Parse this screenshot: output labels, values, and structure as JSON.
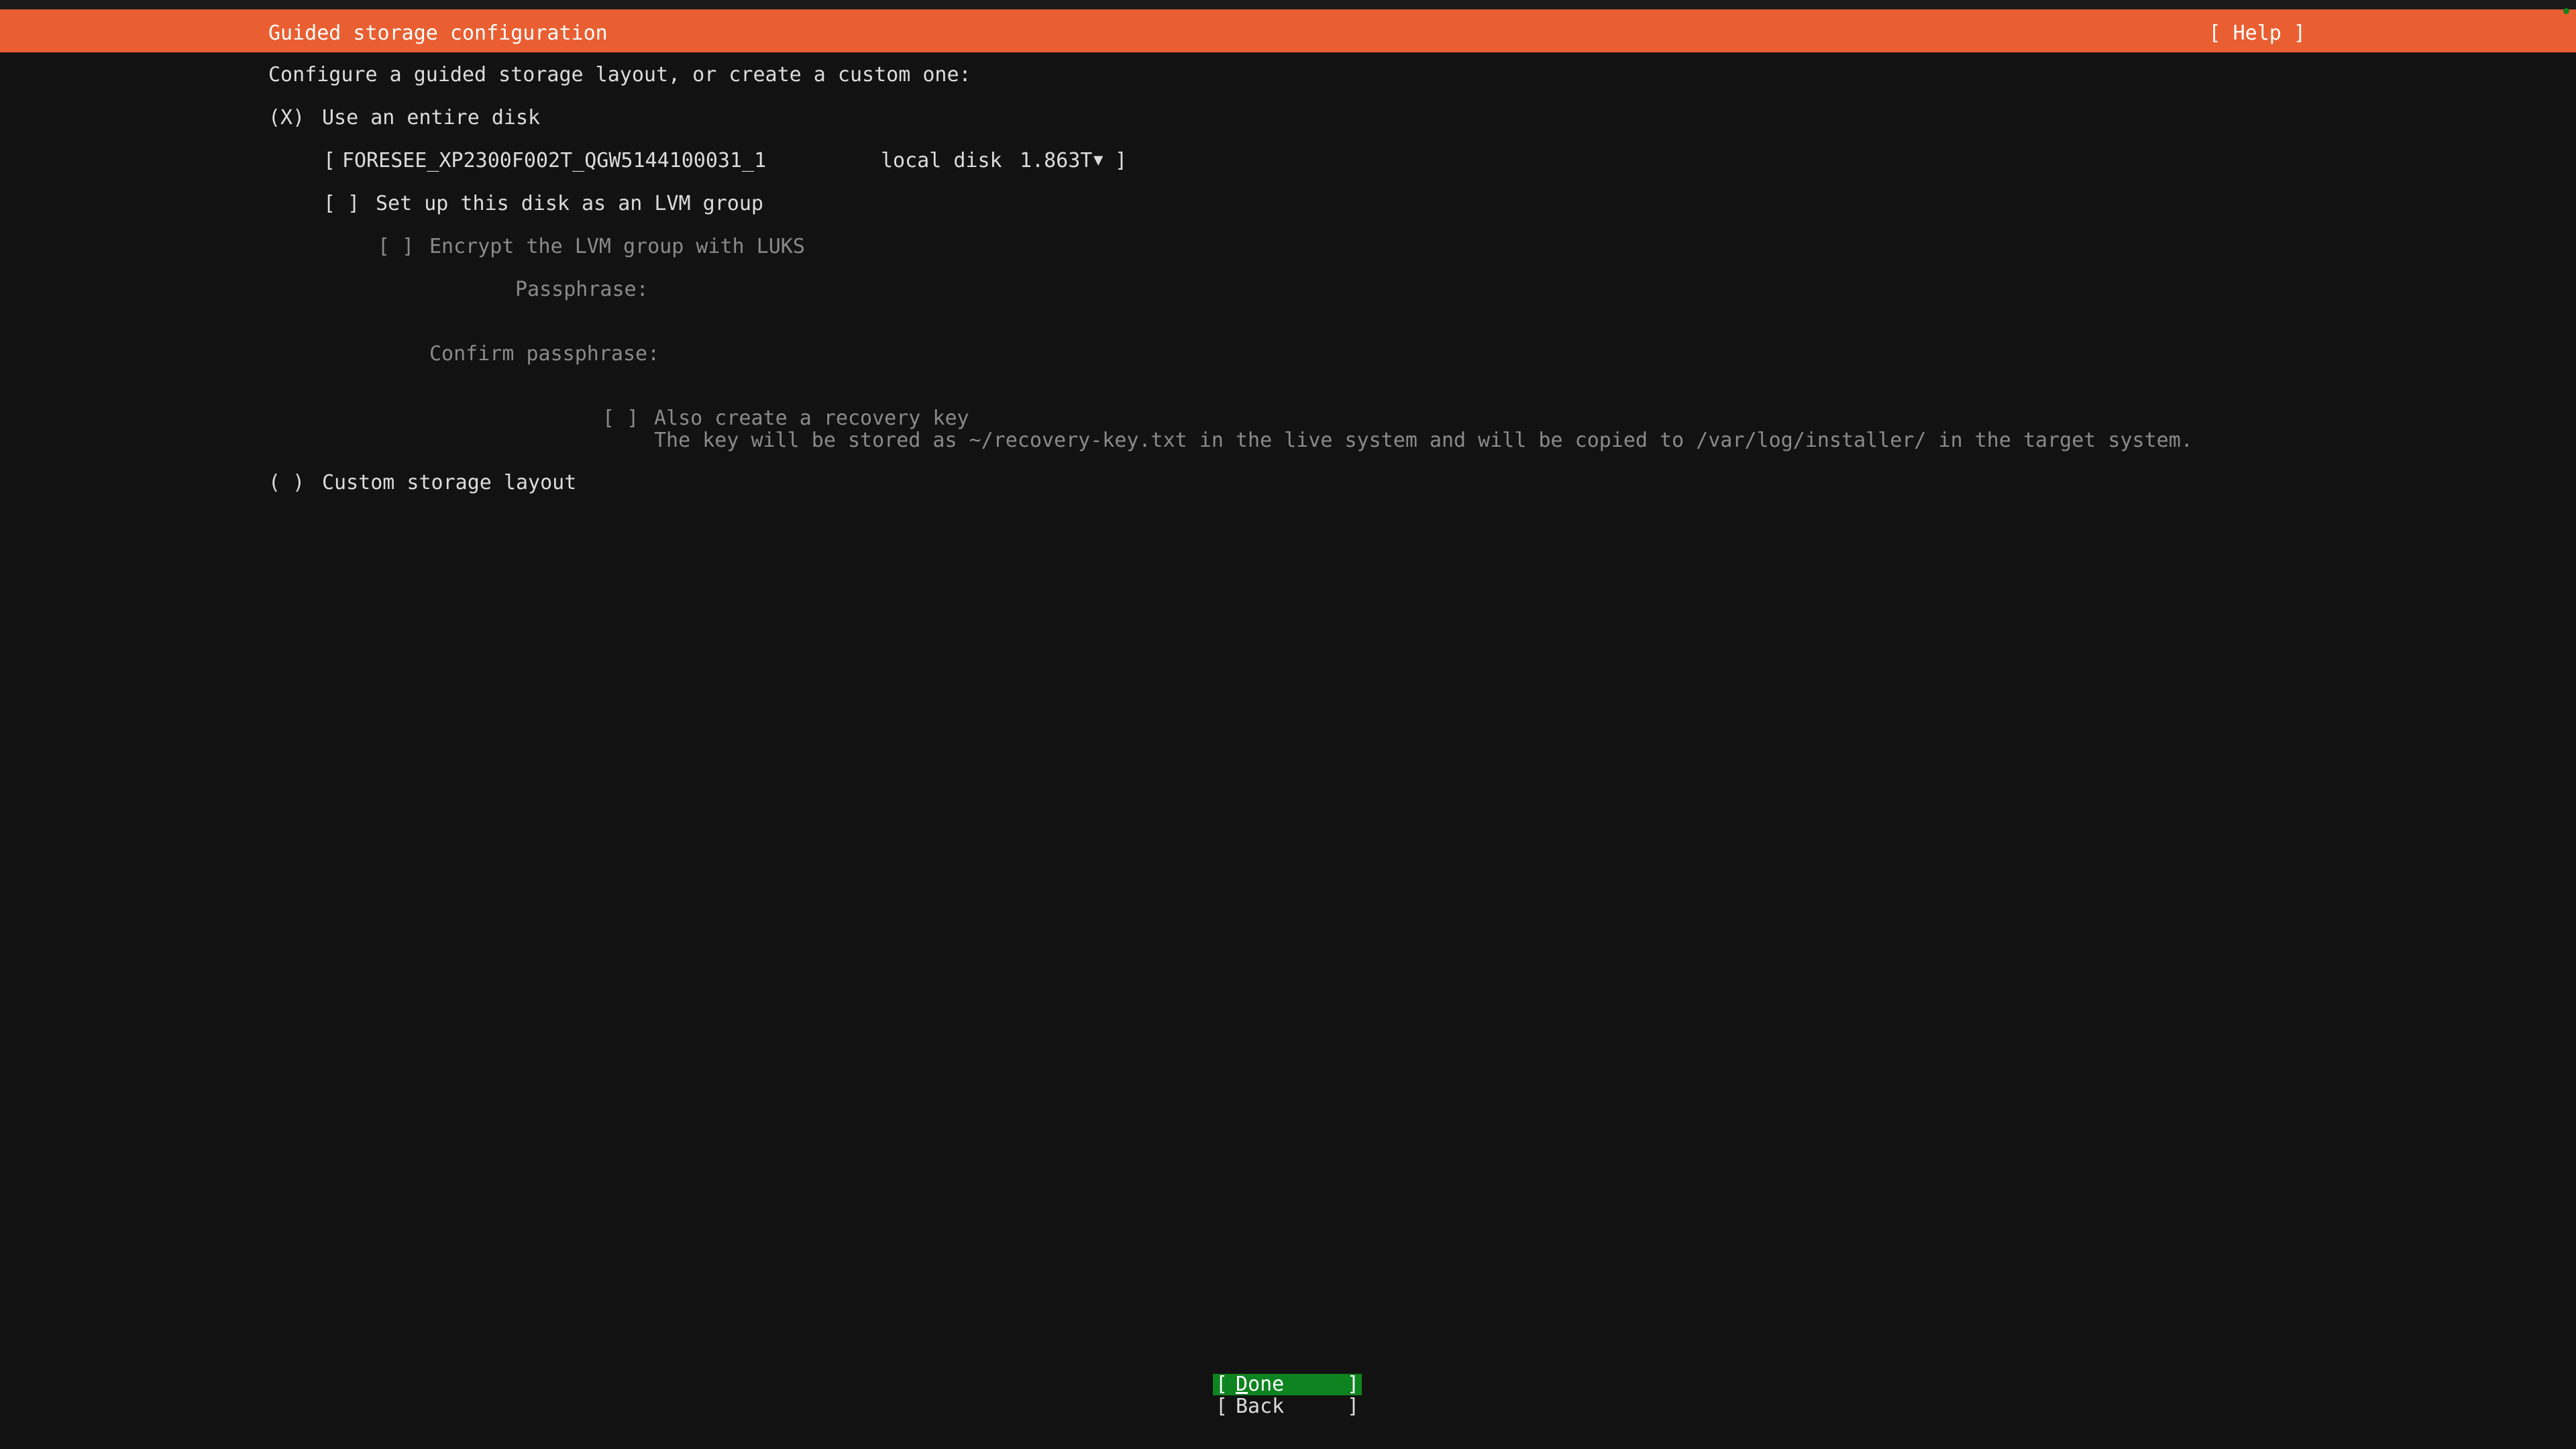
{
  "header": {
    "title": "Guided storage configuration",
    "help_label": "[ Help ]"
  },
  "colors": {
    "header_bg": "#e95f31",
    "background": "#121212",
    "button_selected": "#0e8420",
    "status_dot": "#0e8420"
  },
  "intro": "Configure a guided storage layout, or create a custom one:",
  "options": {
    "entire_disk": {
      "marker": "(X)",
      "label": "Use an entire disk",
      "selected": true
    },
    "disk_select": {
      "open_bracket": "[",
      "name": "FORESEE_XP2300F002T_QGW5144100031_1",
      "type": "local disk",
      "size": "1.863T",
      "arrow_icon": "▼",
      "close_bracket": "]"
    },
    "lvm": {
      "marker": "[ ]",
      "label": "Set up this disk as an LVM group",
      "checked": false
    },
    "encrypt": {
      "marker": "[ ]",
      "label": "Encrypt the LVM group with LUKS",
      "checked": false,
      "disabled": true
    },
    "passphrase": {
      "label": "Passphrase:",
      "value": ""
    },
    "confirm_passphrase": {
      "label": "Confirm passphrase:",
      "value": ""
    },
    "recovery_key": {
      "marker": "[ ]",
      "label": "Also create a recovery key",
      "note": "The key will be stored as ~/recovery-key.txt in the live system and will be copied to /var/log/installer/ in the target system.",
      "checked": false,
      "disabled": true
    },
    "custom": {
      "marker": "( )",
      "label": "Custom storage layout",
      "selected": false
    }
  },
  "buttons": {
    "done": {
      "open": "[",
      "accel": "D",
      "rest": "one",
      "close": "]"
    },
    "back": {
      "open": "[",
      "label": "Back",
      "close": "]"
    }
  }
}
